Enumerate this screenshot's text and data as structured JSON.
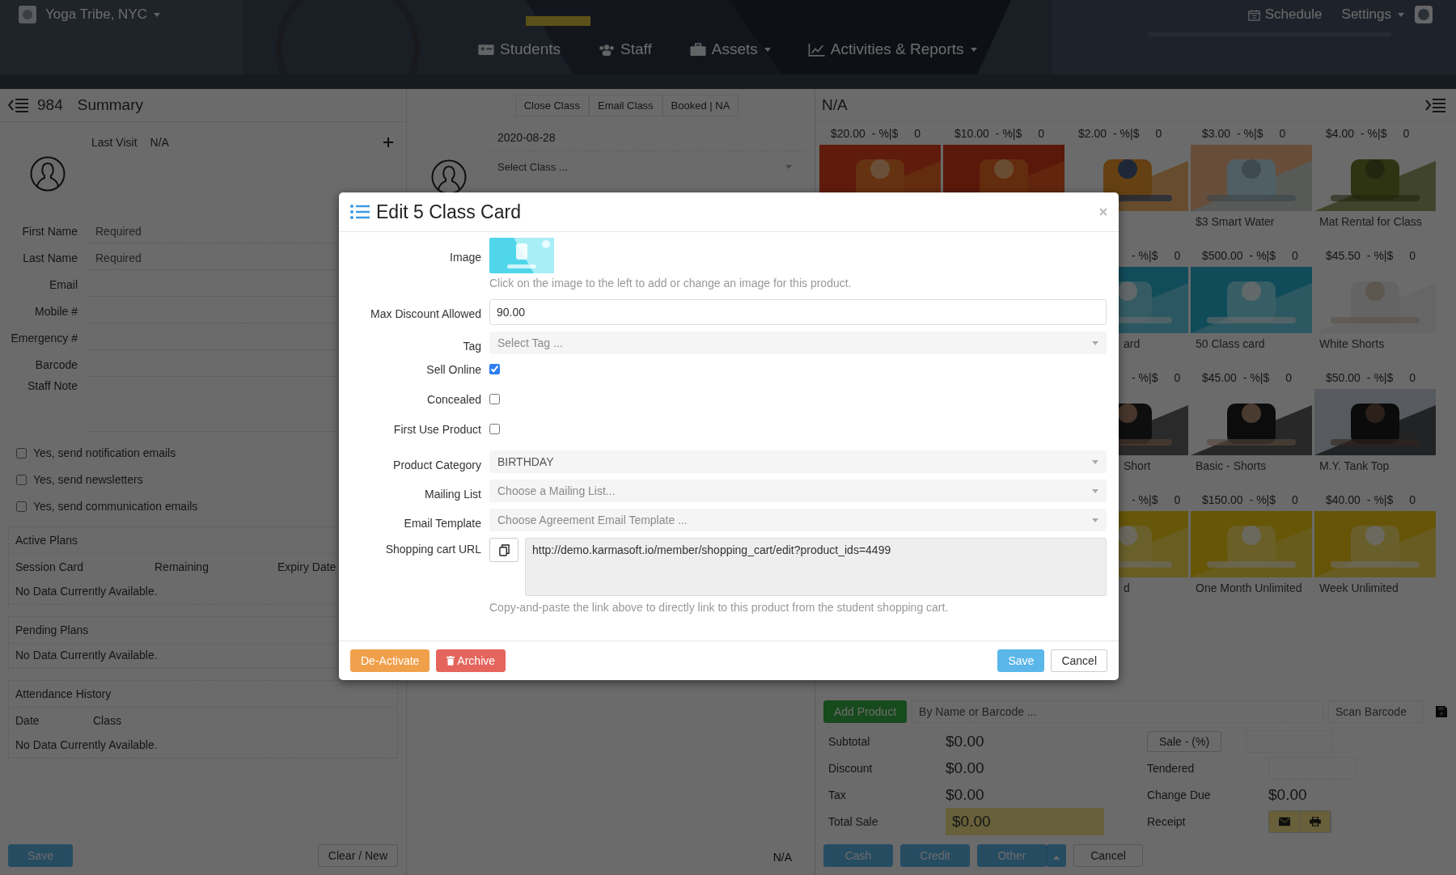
{
  "navbar": {
    "brand": {
      "label": "Yoga Tribe, NYC",
      "dropdown": true
    },
    "links": [
      {
        "label": "Students",
        "dropdown": false
      },
      {
        "label": "Staff",
        "dropdown": false
      },
      {
        "label": "Assets",
        "dropdown": true
      },
      {
        "label": "Activities & Reports",
        "dropdown": true
      }
    ],
    "right": [
      {
        "label": "Schedule",
        "dropdown": false
      },
      {
        "label": "Settings",
        "dropdown": true
      }
    ]
  },
  "student_panel": {
    "count": "984",
    "title": "Summary",
    "last_visit": {
      "label": "Last Visit",
      "value": "N/A"
    },
    "fields": [
      {
        "kind": "input",
        "label": "First Name",
        "placeholder": "Required"
      },
      {
        "kind": "input",
        "label": "Last Name",
        "placeholder": "Required"
      },
      {
        "kind": "input",
        "label": "Email"
      },
      {
        "kind": "input",
        "label": "Mobile #"
      },
      {
        "kind": "input",
        "label": "Emergency #"
      },
      {
        "kind": "input",
        "label": "Barcode"
      },
      {
        "kind": "textarea",
        "label": "Staff Note"
      }
    ],
    "options": [
      {
        "label": "Yes, send notification emails",
        "checked": false
      },
      {
        "label": "Yes, send newsletters",
        "checked": false
      },
      {
        "label": "Yes, send communication emails",
        "checked": false
      }
    ],
    "sections": [
      {
        "title": "Active Plans",
        "columns": [
          "Session Card",
          "Remaining",
          "Expiry Date"
        ],
        "empty": "No Data Currently Available."
      },
      {
        "title": "Pending Plans",
        "empty": "No Data Currently Available."
      },
      {
        "title": "Attendance History",
        "columns": [
          "Date",
          "Class"
        ],
        "empty": "No Data Currently Available."
      }
    ],
    "buttons": [
      {
        "label": "Save",
        "kind": "primary"
      },
      {
        "label": "Clear / New",
        "kind": "default"
      }
    ]
  },
  "class_panel": {
    "actions": [
      "Close Class",
      "Email Class",
      "Booked | NA"
    ],
    "date": "2020-08-28",
    "class_select": {
      "placeholder": "Select Class ..."
    },
    "footer": "N/A"
  },
  "sale_panel": {
    "title": "N/A",
    "product_rows": [
      [
        {
          "kind": "full",
          "price": "$20.00",
          "discount": "- %|$",
          "count": "0"
        },
        {
          "kind": "full",
          "price": "$10.00",
          "discount": "- %|$",
          "count": "0"
        },
        {
          "kind": "full",
          "price": "$2.00",
          "discount": "- %|$",
          "count": "0"
        },
        {
          "kind": "full",
          "price": "$3.00",
          "discount": "- %|$",
          "count": "0",
          "name": "$3 Smart Water"
        },
        {
          "kind": "full",
          "price": "$4.00",
          "discount": "- %|$",
          "count": "0",
          "name": "Mat Rental for Class"
        }
      ],
      [
        {
          "kind": "partial",
          "discount": "- %|$",
          "count": "0",
          "name": "ard"
        },
        {
          "kind": "full",
          "price": "$500.00",
          "discount": "- %|$",
          "count": "0",
          "name": "50 Class card"
        },
        {
          "kind": "full",
          "price": "$45.50",
          "discount": "- %|$",
          "count": "0",
          "name": "White Shorts"
        }
      ],
      [
        {
          "kind": "partial",
          "discount": "- %|$",
          "count": "0",
          "name": "Short"
        },
        {
          "kind": "full",
          "price": "$45.00",
          "discount": "- %|$",
          "count": "0",
          "name": "Basic - Shorts"
        },
        {
          "kind": "full",
          "price": "$50.00",
          "discount": "- %|$",
          "count": "0",
          "name": "M.Y. Tank Top"
        }
      ],
      [
        {
          "kind": "partial",
          "discount": "- %|$",
          "count": "0",
          "name": "d"
        },
        {
          "kind": "full",
          "price": "$150.00",
          "discount": "- %|$",
          "count": "0",
          "name": "One Month Unlimited"
        },
        {
          "kind": "full",
          "price": "$40.00",
          "discount": "- %|$",
          "count": "0",
          "name": "Week Unlimited"
        }
      ]
    ],
    "add_product": "Add Product",
    "search": {
      "placeholder": "By Name or Barcode ..."
    },
    "scan": {
      "placeholder": "Scan Barcode"
    },
    "totals": [
      {
        "label": "Subtotal",
        "value": "$0.00"
      },
      {
        "label": "Discount",
        "value": "$0.00"
      },
      {
        "label": "Tax",
        "value": "$0.00"
      },
      {
        "label": "Total Sale",
        "value": "$0.00"
      }
    ],
    "sale_button": "Sale - (%)",
    "tendered": "Tendered",
    "change_due": {
      "label": "Change Due",
      "value": "$0.00"
    },
    "receipt": "Receipt",
    "payment_buttons": [
      {
        "label": "Cash",
        "kind": "primary"
      },
      {
        "label": "Credit",
        "kind": "primary"
      },
      {
        "label": "Other",
        "kind": "split"
      },
      {
        "label": "Cancel",
        "kind": "default"
      }
    ]
  },
  "modal": {
    "title": "Edit 5 Class Card",
    "fields": [
      {
        "label": "Image",
        "help": "Click on the image to the left to add or change an image for this product."
      },
      {
        "kind": "input",
        "label": "Max Discount Allowed",
        "value": "90.00"
      },
      {
        "kind": "select",
        "label": "Tag",
        "placeholder": "Select Tag ..."
      },
      {
        "kind": "checkbox",
        "label": "Sell Online",
        "checked": true
      },
      {
        "kind": "checkbox",
        "label": "Concealed",
        "checked": false
      },
      {
        "kind": "checkbox",
        "label": "First Use Product",
        "checked": false
      },
      {
        "kind": "select",
        "label": "Product Category",
        "value": "BIRTHDAY"
      },
      {
        "kind": "select",
        "label": "Mailing List",
        "placeholder": "Choose a Mailing List..."
      },
      {
        "kind": "select",
        "label": "Email Template",
        "placeholder": "Choose Agreement Email Template ..."
      },
      {
        "kind": "url",
        "label": "Shopping cart URL",
        "value": "http://demo.karmasoft.io/member/shopping_cart/edit?product_ids=4499",
        "help": "Copy-and-paste the link above to directly link to this product from the student shopping cart."
      }
    ],
    "buttons": [
      {
        "label": "De-Activate",
        "kind": "warning"
      },
      {
        "label": "Archive",
        "kind": "danger"
      },
      {
        "label": "Save",
        "kind": "primary"
      },
      {
        "label": "Cancel",
        "kind": "default"
      }
    ]
  }
}
